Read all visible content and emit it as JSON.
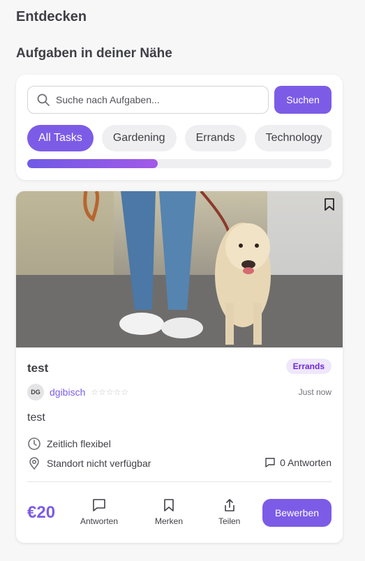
{
  "header": {
    "title": "Entdecken",
    "section_title": "Aufgaben in deiner Nähe"
  },
  "search": {
    "placeholder": "Suche nach Aufgaben...",
    "button_label": "Suchen"
  },
  "filters": {
    "chips": [
      {
        "label": "All Tasks",
        "active": true
      },
      {
        "label": "Gardening",
        "active": false
      },
      {
        "label": "Errands",
        "active": false
      },
      {
        "label": "Technology",
        "active": false
      }
    ],
    "scroll_position_fraction": 0.43
  },
  "task": {
    "title": "test",
    "category": "Errands",
    "author": {
      "initials": "DG",
      "name": "dgibisch",
      "rating_stars": "☆☆☆☆☆",
      "rating": 0
    },
    "posted": "Just now",
    "description": "test",
    "time": "Zeitlich flexibel",
    "location": "Standort nicht verfügbar",
    "replies": "0 Antworten",
    "price": "€20",
    "actions": {
      "reply": "Antworten",
      "save": "Merken",
      "share": "Teilen"
    },
    "apply_label": "Bewerben"
  },
  "colors": {
    "accent": "#7c5ce6",
    "badge_bg": "#efe7fb",
    "badge_text": "#6d28d9"
  },
  "icons": [
    "search-icon",
    "bookmark-icon",
    "clock-icon",
    "location-pin-icon",
    "chat-bubble-icon",
    "share-icon"
  ]
}
